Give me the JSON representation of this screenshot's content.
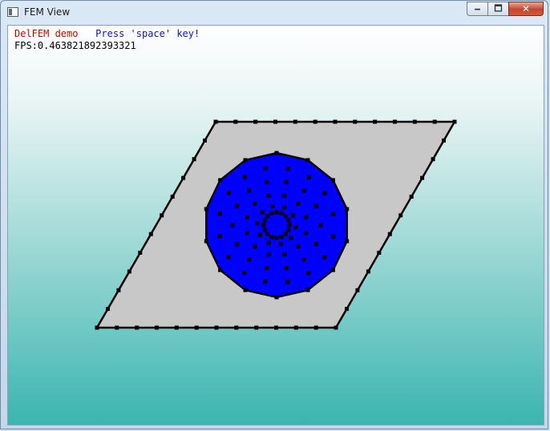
{
  "window": {
    "title": "FEM View",
    "min_glyph": "🗕",
    "max_glyph": "🗖",
    "close_glyph": "✕"
  },
  "hud": {
    "demo_label": "DelFEM demo",
    "hint": "Press 'space' key!",
    "fps": "FPS:0.463821892393321"
  },
  "colors": {
    "plate_fill": "#c8c8c8",
    "disk_fill": "#0000ff",
    "edge": "#000000",
    "demo_label": "#d00000",
    "hint": "#1010c0"
  }
}
